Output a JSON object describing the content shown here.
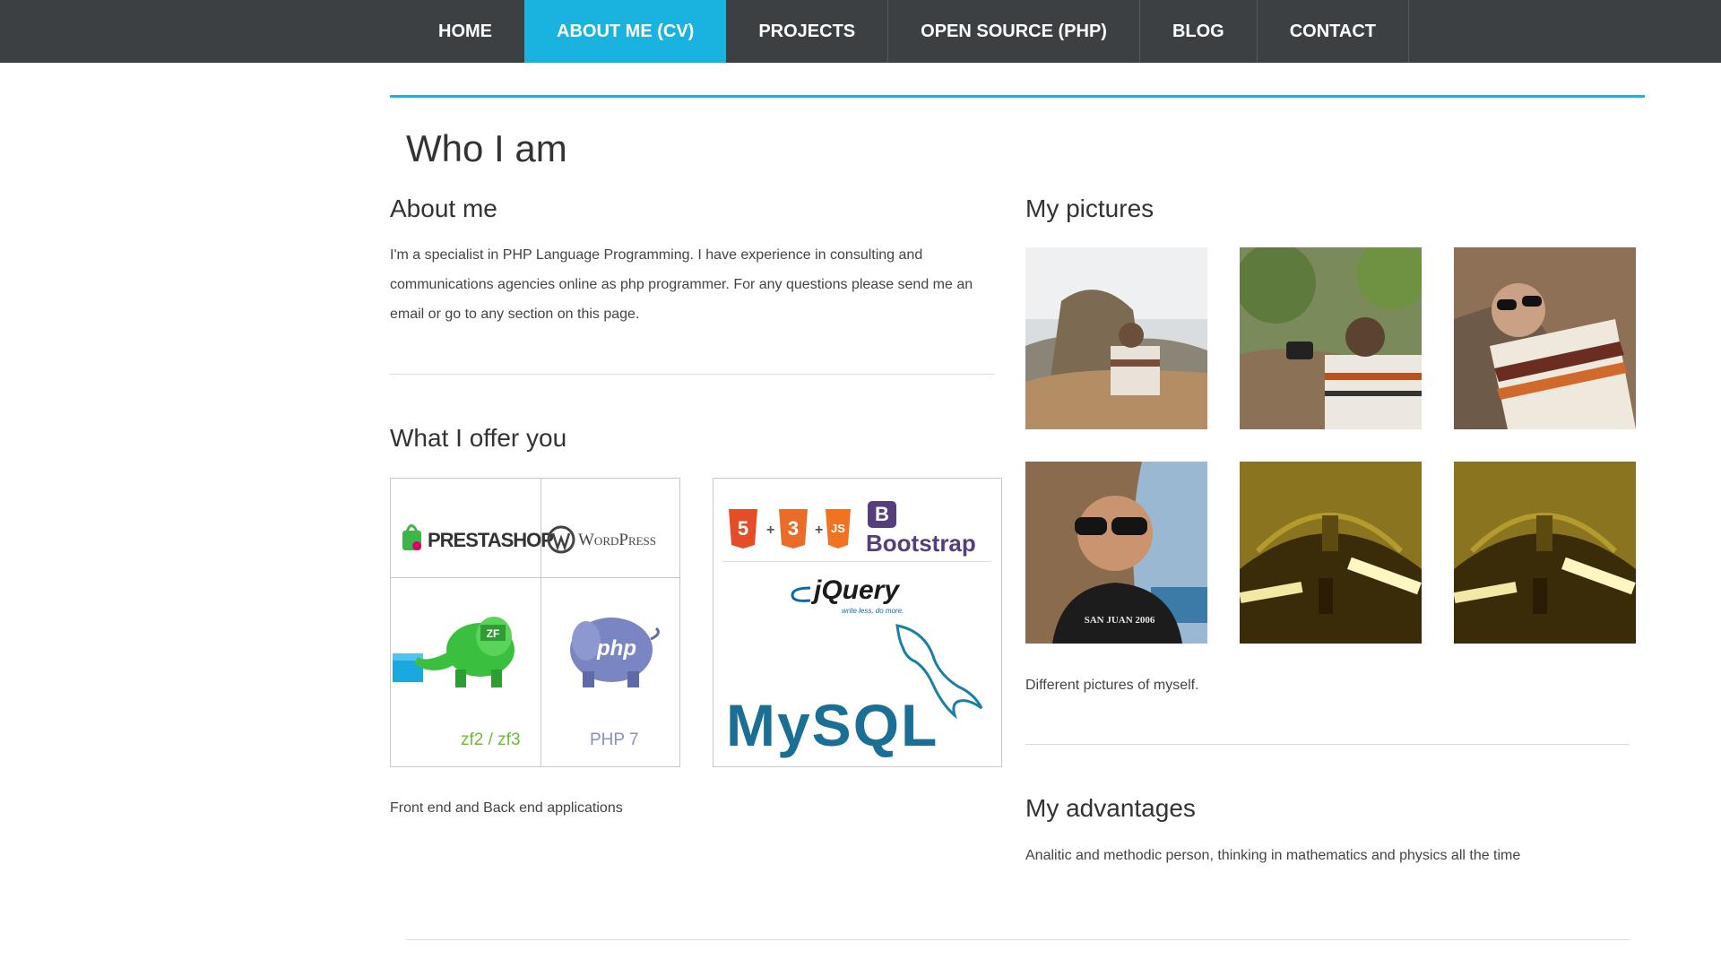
{
  "nav": {
    "items": [
      {
        "label": "HOME"
      },
      {
        "label": "ABOUT ME (CV)"
      },
      {
        "label": "PROJECTS"
      },
      {
        "label": "OPEN SOURCE (PHP)"
      },
      {
        "label": "BLOG"
      },
      {
        "label": "CONTACT"
      }
    ],
    "active_index": 1
  },
  "page_title": "Who I am",
  "about": {
    "title": "About me",
    "text": "I'm a specialist in PHP Language Programming. I have experience in consulting and communications agencies online as php programmer. For any questions please send me an email or go to any section on this page."
  },
  "offer": {
    "title": "What I offer you",
    "caption": "Front end and Back end applications",
    "logos": {
      "prestashop": "PRESTASHOP",
      "wordpress": "WordPress",
      "zf_badge": "ZF",
      "zf_label": "zf2 / zf3",
      "php_badge": "php",
      "php_label": "PHP 7",
      "html5": "5",
      "css3": "3",
      "js": "JS",
      "bootstrap_badge": "B",
      "bootstrap": "Bootstrap",
      "jquery": "jQuery",
      "jquery_tag": "write less, do more.",
      "mysql": "MySQL"
    }
  },
  "pictures": {
    "title": "My pictures",
    "caption": "Different pictures of myself.",
    "shirt_text": "SAN JUAN 2006"
  },
  "advantages": {
    "title": "My advantages",
    "text": "Analitic and methodic person, thinking in mathematics and physics all the time"
  },
  "colors": {
    "nav_bg": "#3d4043",
    "accent": "#1ab3df",
    "text": "#333333"
  }
}
